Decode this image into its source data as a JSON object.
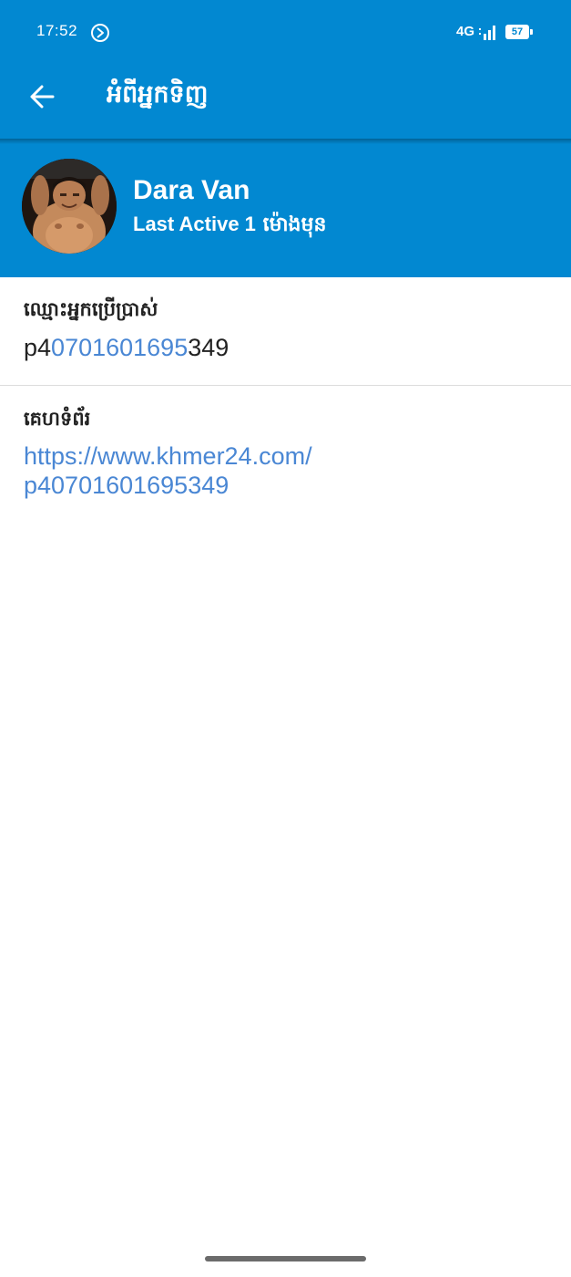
{
  "status_bar": {
    "time": "17:52",
    "network": "4G",
    "battery": "57"
  },
  "app_bar": {
    "title": "អំពីអ្នកទិញ"
  },
  "profile": {
    "name": "Dara Van",
    "last_active_prefix": "Last Active 1",
    "last_active_suffix": "ម៉ោងមុន"
  },
  "username": {
    "label": "ឈ្មោះអ្នកប្រើប្រាស់",
    "value_prefix": "p4",
    "value_phone": "0701601695",
    "value_suffix": "349"
  },
  "website": {
    "label": "គេហទំព័រ",
    "url_line1": "https://www.khmer24.com/",
    "url_line2": "p40701601695349"
  },
  "colors": {
    "primary": "#0288d1",
    "link": "#4a87d4",
    "text": "#222222"
  }
}
